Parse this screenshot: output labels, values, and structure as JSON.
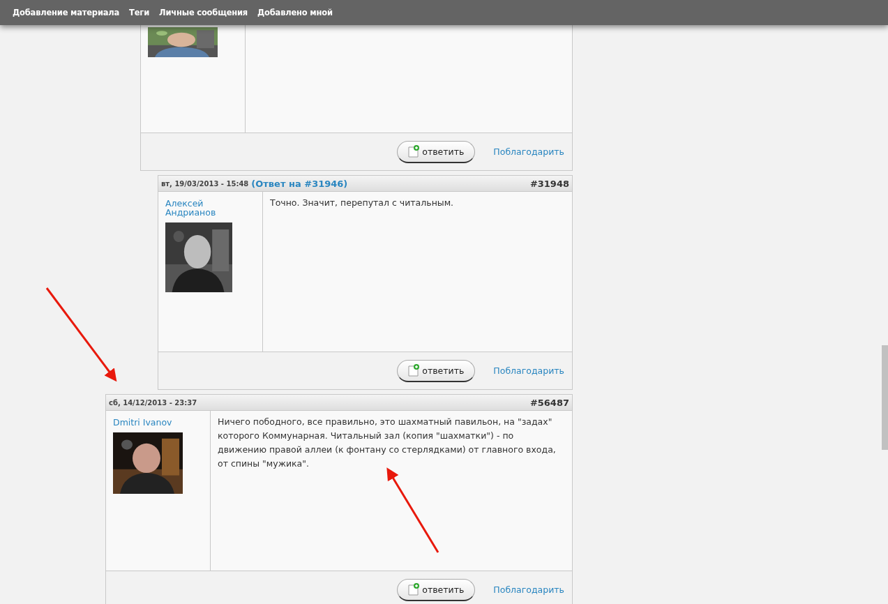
{
  "nav": [
    "Добавление материала",
    "Теги",
    "Личные сообщения",
    "Добавлено мной"
  ],
  "comments": [
    {
      "reply_button": "ответить",
      "thank_link": "Поблагодарить"
    },
    {
      "date": "вт, 19/03/2013 - 15:48",
      "reply_to": "(Ответ на #31946)",
      "number": "#31948",
      "author": "Алексей Андрианов",
      "body": "Точно. Значит, перепутал с читальным.",
      "reply_button": "ответить",
      "thank_link": "Поблагодарить"
    },
    {
      "date": "сб, 14/12/2013 - 23:37",
      "number": "#56487",
      "author": "Dmitri Ivanov",
      "body": "Ничего пободного, все правильно, это шахматный павильон, на \"задах\" которого Коммунарная. Читальный зал (копия \"шахматки\") - по движению правой аллеи (к фонтану со стерлядками) от главного входа, от спины \"мужика\".",
      "reply_button": "ответить",
      "thank_link": "Поблагодарить"
    }
  ]
}
